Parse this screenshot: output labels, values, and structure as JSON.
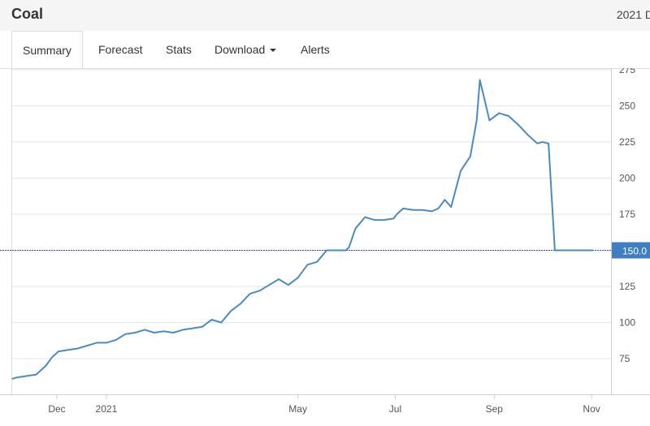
{
  "header": {
    "title": "Coal",
    "right_text": "2021 D"
  },
  "tabs": [
    {
      "label": "Summary",
      "active": true
    },
    {
      "label": "Forecast"
    },
    {
      "label": "Stats"
    },
    {
      "label": "Download",
      "has_dropdown": true
    },
    {
      "label": "Alerts"
    }
  ],
  "colors": {
    "line": "#4a8bc2",
    "price_tag": "#3f7fc1",
    "reference_line": "#4444aa",
    "grid": "#e6e6e6"
  },
  "chart_data": {
    "type": "line",
    "title": "",
    "xlabel": "",
    "ylabel": "",
    "ylim": [
      50,
      275
    ],
    "y_ticks": [
      75,
      100,
      125,
      150,
      175,
      200,
      225,
      250,
      275
    ],
    "x_ticks": [
      "Dec",
      "2021",
      "May",
      "Jul",
      "Sep",
      "Nov"
    ],
    "x_tick_dates": [
      "2020-12-01",
      "2021-01-01",
      "2021-05-01",
      "2021-07-01",
      "2021-09-01",
      "2021-11-01"
    ],
    "x_range": [
      "2020-11-03",
      "2021-11-04"
    ],
    "current_value_label": "150.0",
    "current_value": 150,
    "grid": true,
    "series": [
      {
        "x": [
          "2020-11-03",
          "2020-11-06",
          "2020-11-12",
          "2020-11-18",
          "2020-11-24",
          "2020-11-28",
          "2020-12-02",
          "2020-12-08",
          "2020-12-14",
          "2020-12-20",
          "2020-12-26",
          "2021-01-01",
          "2021-01-07",
          "2021-01-13",
          "2021-01-19",
          "2021-01-25",
          "2021-01-31",
          "2021-02-06",
          "2021-02-12",
          "2021-02-18",
          "2021-02-24",
          "2021-03-02",
          "2021-03-08",
          "2021-03-14",
          "2021-03-20",
          "2021-03-26",
          "2021-04-01",
          "2021-04-07",
          "2021-04-13",
          "2021-04-19",
          "2021-04-25",
          "2021-05-01",
          "2021-05-07",
          "2021-05-13",
          "2021-05-19",
          "2021-05-25",
          "2021-05-31",
          "2021-06-02",
          "2021-06-06",
          "2021-06-12",
          "2021-06-18",
          "2021-06-24",
          "2021-06-30",
          "2021-07-02",
          "2021-07-06",
          "2021-07-12",
          "2021-07-18",
          "2021-07-24",
          "2021-07-28",
          "2021-08-01",
          "2021-08-05",
          "2021-08-11",
          "2021-08-17",
          "2021-08-21",
          "2021-08-23",
          "2021-08-29",
          "2021-09-04",
          "2021-09-10",
          "2021-09-16",
          "2021-09-22",
          "2021-09-26",
          "2021-09-28",
          "2021-10-01",
          "2021-10-05",
          "2021-10-09",
          "2021-10-12",
          "2021-10-16",
          "2021-10-19",
          "2021-10-23",
          "2021-10-27",
          "2021-10-31",
          "2021-11-02"
        ],
        "y": [
          61,
          62,
          63,
          64,
          70,
          76,
          80,
          81,
          82,
          84,
          86,
          86,
          88,
          92,
          93,
          95,
          93,
          94,
          93,
          95,
          96,
          97,
          102,
          100,
          108,
          113,
          120,
          122,
          126,
          130,
          126,
          131,
          140,
          142,
          150,
          150,
          150,
          152,
          165,
          173,
          171,
          171,
          172,
          175,
          179,
          178,
          178,
          177,
          179,
          185,
          180,
          205,
          215,
          240,
          268,
          240,
          245,
          243,
          237,
          230,
          226,
          224,
          225,
          224,
          150,
          150,
          150,
          150,
          150,
          150,
          150,
          150
        ],
        "_note_ignore": ""
      }
    ]
  }
}
